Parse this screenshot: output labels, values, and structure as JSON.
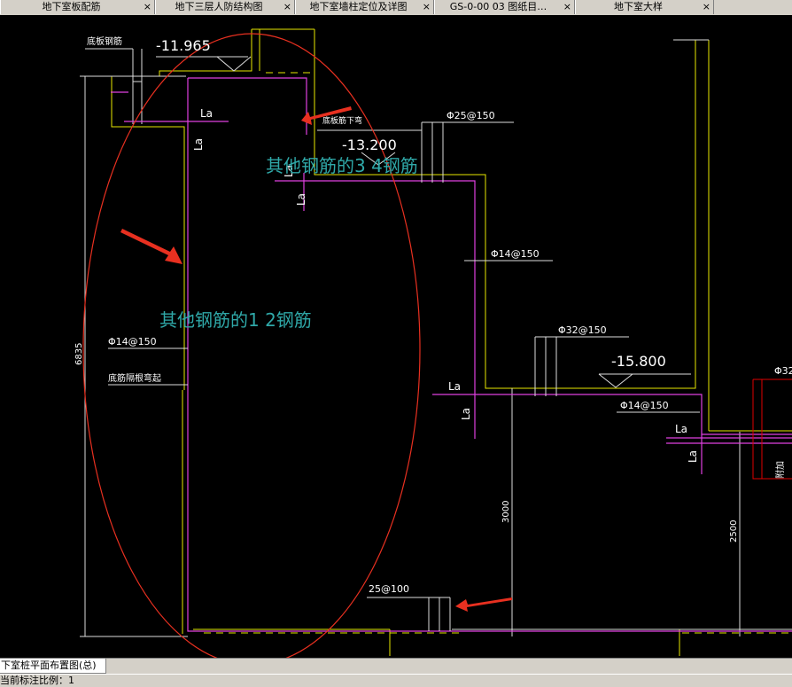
{
  "tabs": [
    {
      "label": "地下室板配筋",
      "close": "×"
    },
    {
      "label": "地下三层人防结构图",
      "close": "×"
    },
    {
      "label": "地下室墙柱定位及详图",
      "close": "×"
    },
    {
      "label": "GS-0-00 03   图纸目…",
      "close": "×"
    },
    {
      "label": "地下室大样",
      "close": "×"
    }
  ],
  "drawing": {
    "elev1": "-11.965",
    "elev2": "-13.200",
    "elev3": "-15.800",
    "label_bottom_rebar": "底板钢筋",
    "label_bend_down": "底板筋下弯",
    "rebar_25_150": "Φ25@150",
    "rebar_14_150_a": "Φ14@150",
    "rebar_32_150": "Φ32@150",
    "rebar_14_150_b": "Φ14@150",
    "rebar_14_150_left": "Φ14@150",
    "rebar_25_100": "25@100",
    "label_corner": "底筋隔根弯起",
    "la_1": "La",
    "la_2": "La",
    "la_3": "La",
    "la_4": "La",
    "la_5": "La",
    "la_6": "La",
    "la_7": "La",
    "la_8": "La",
    "dim_6835": "6835",
    "dim_3000": "3000",
    "dim_2500": "2500",
    "phi32_cut": "Φ32",
    "cut_label": "附加",
    "annotation_34": "其他钢筋的3 4钢筋",
    "annotation_12": "其他钢筋的1 2钢筋"
  },
  "layout_tab": "下室桩平面布置图(总)",
  "status": "当前标注比例：1"
}
